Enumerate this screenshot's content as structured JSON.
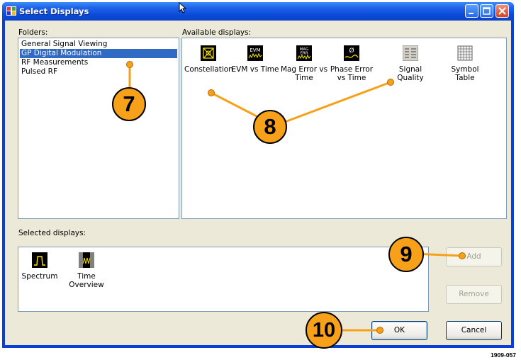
{
  "window": {
    "title": "Select Displays",
    "title_icon": "app-window-icon",
    "controls": [
      "minimize-icon",
      "maximize-icon",
      "close-icon"
    ]
  },
  "folders": {
    "label": "Folders:",
    "items": [
      {
        "label": "General Signal Viewing",
        "selected": false
      },
      {
        "label": "GP Digital Modulation",
        "selected": true
      },
      {
        "label": "RF Measurements",
        "selected": false
      },
      {
        "label": "Pulsed RF",
        "selected": false
      }
    ]
  },
  "available": {
    "label": "Available displays:",
    "items": [
      {
        "label": "Constellation",
        "icon": "constellation-icon",
        "icon_text": ""
      },
      {
        "label": "EVM vs Time",
        "icon": "evm-icon",
        "icon_text": "EVM"
      },
      {
        "label": "Mag Error vs\nTime",
        "icon": "mag-error-icon",
        "icon_text": "MAG\nERR"
      },
      {
        "label": "Phase Error\nvs Time",
        "icon": "phase-error-icon",
        "icon_text": "Ø"
      },
      {
        "label": "Signal\nQuality",
        "icon": "signal-quality-icon",
        "icon_text": ""
      },
      {
        "label": "Symbol\nTable",
        "icon": "symbol-table-icon",
        "icon_text": ""
      }
    ]
  },
  "selected": {
    "label": "Selected displays:",
    "items": [
      {
        "label": "Spectrum",
        "icon": "spectrum-icon"
      },
      {
        "label": "Time\nOverview",
        "icon": "time-overview-icon"
      }
    ]
  },
  "buttons": {
    "add": "Add",
    "remove": "Remove",
    "ok": "OK",
    "cancel": "Cancel"
  },
  "callouts": [
    "7",
    "8",
    "9",
    "10"
  ],
  "figure_id": "1909-057",
  "colors": {
    "titlebar": "#0a4ad8",
    "selection": "#316ac5",
    "callout_fill": "#f7a11b",
    "dialog_bg": "#ece9d8"
  }
}
